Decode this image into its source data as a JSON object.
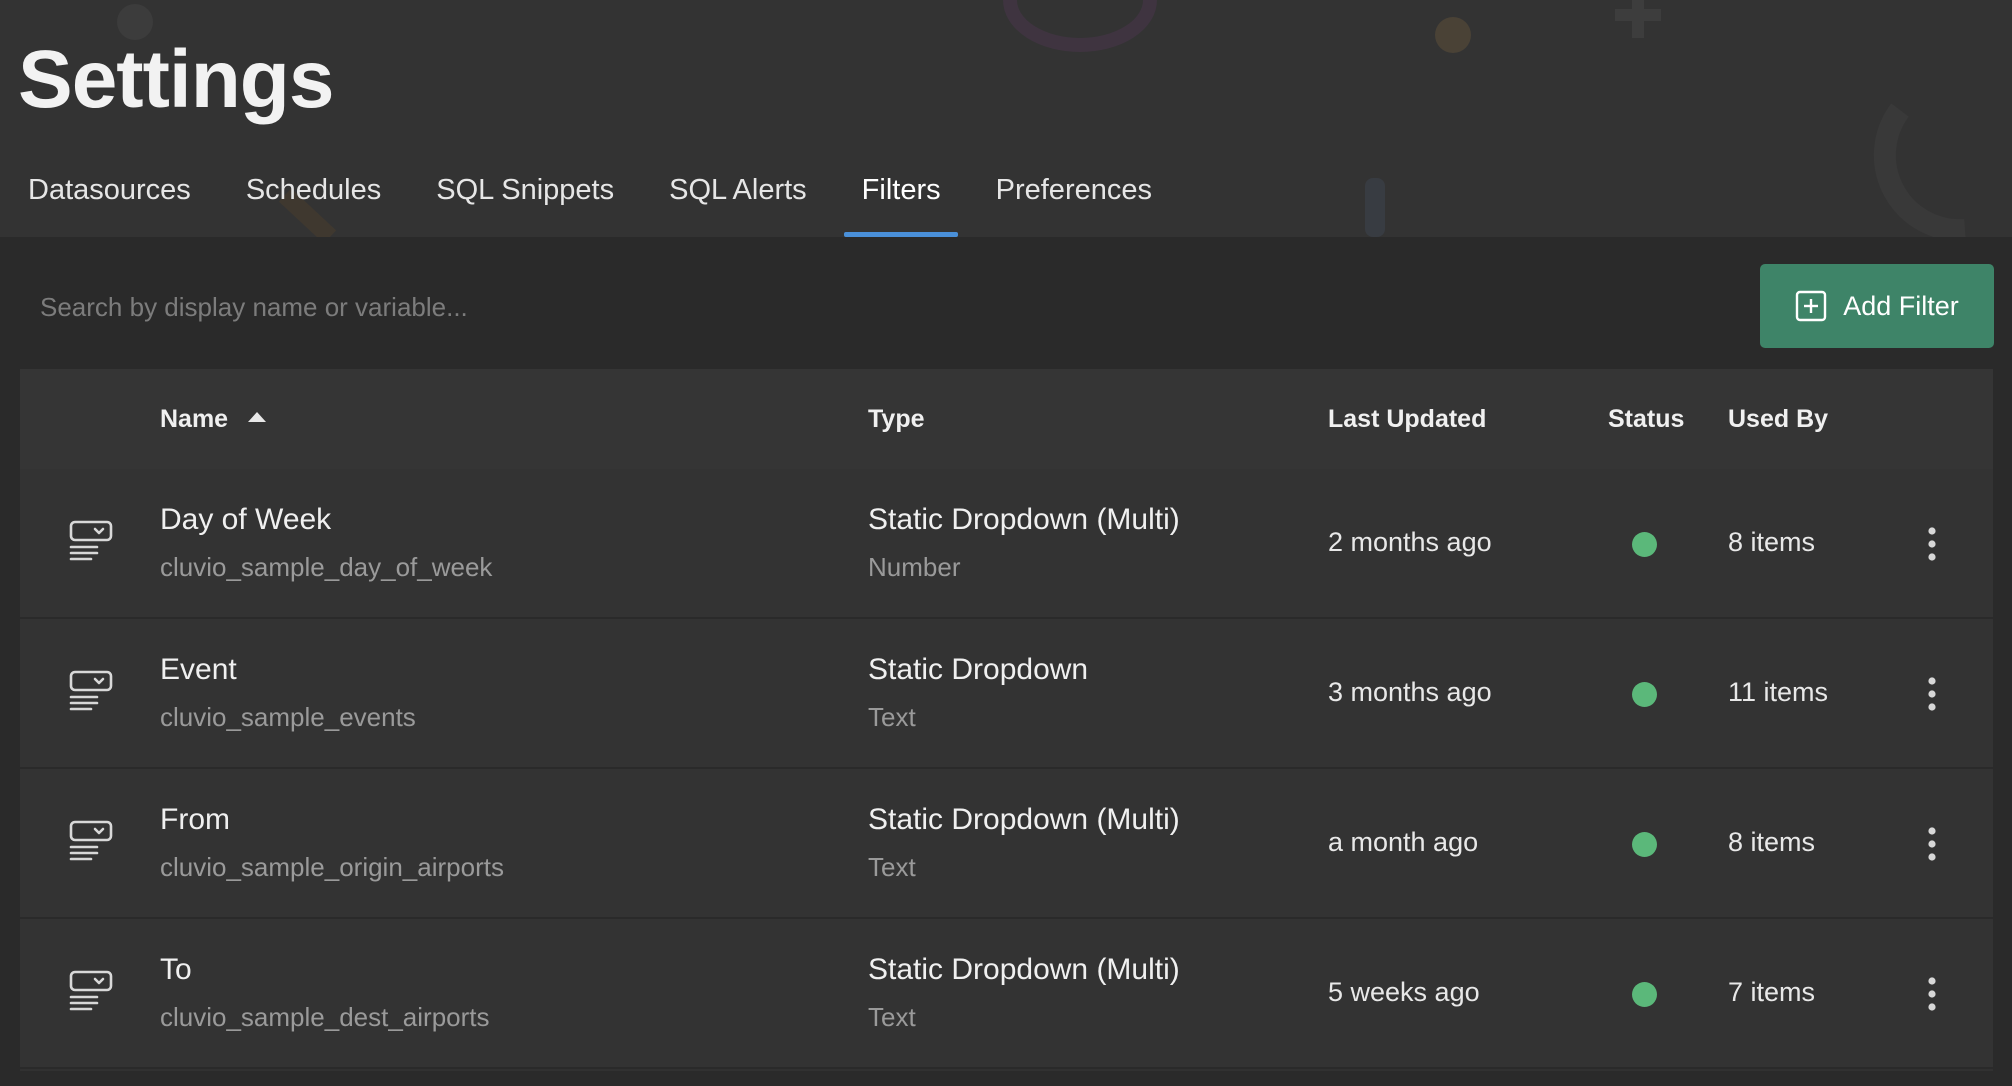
{
  "page": {
    "title": "Settings"
  },
  "tabs": [
    {
      "label": "Datasources",
      "active": false
    },
    {
      "label": "Schedules",
      "active": false
    },
    {
      "label": "SQL Snippets",
      "active": false
    },
    {
      "label": "SQL Alerts",
      "active": false
    },
    {
      "label": "Filters",
      "active": true
    },
    {
      "label": "Preferences",
      "active": false
    }
  ],
  "search": {
    "placeholder": "Search by display name or variable...",
    "value": ""
  },
  "toolbar": {
    "add_label": "Add Filter",
    "add_icon": "plus-square-icon"
  },
  "table": {
    "columns": {
      "name": "Name",
      "type": "Type",
      "last_updated": "Last Updated",
      "status": "Status",
      "used_by": "Used By"
    },
    "sort": {
      "column": "name",
      "direction": "ascending"
    },
    "rows": [
      {
        "icon": "filter-dropdown-icon",
        "name": "Day of Week",
        "variable": "cluvio_sample_day_of_week",
        "type": "Static Dropdown (Multi)",
        "value_type": "Number",
        "last_updated": "2 months ago",
        "status_color": "#5bb87a",
        "used_by": "8 items"
      },
      {
        "icon": "filter-dropdown-icon",
        "name": "Event",
        "variable": "cluvio_sample_events",
        "type": "Static Dropdown",
        "value_type": "Text",
        "last_updated": "3 months ago",
        "status_color": "#5bb87a",
        "used_by": "11 items"
      },
      {
        "icon": "filter-dropdown-icon",
        "name": "From",
        "variable": "cluvio_sample_origin_airports",
        "type": "Static Dropdown (Multi)",
        "value_type": "Text",
        "last_updated": "a month ago",
        "status_color": "#5bb87a",
        "used_by": "8 items"
      },
      {
        "icon": "filter-dropdown-icon",
        "name": "To",
        "variable": "cluvio_sample_dest_airports",
        "type": "Static Dropdown (Multi)",
        "value_type": "Text",
        "last_updated": "5 weeks ago",
        "status_color": "#5bb87a",
        "used_by": "7 items"
      }
    ]
  },
  "colors": {
    "accent": "#4a90d9",
    "primary_button": "#3e8468",
    "status_ok": "#5bb87a"
  }
}
